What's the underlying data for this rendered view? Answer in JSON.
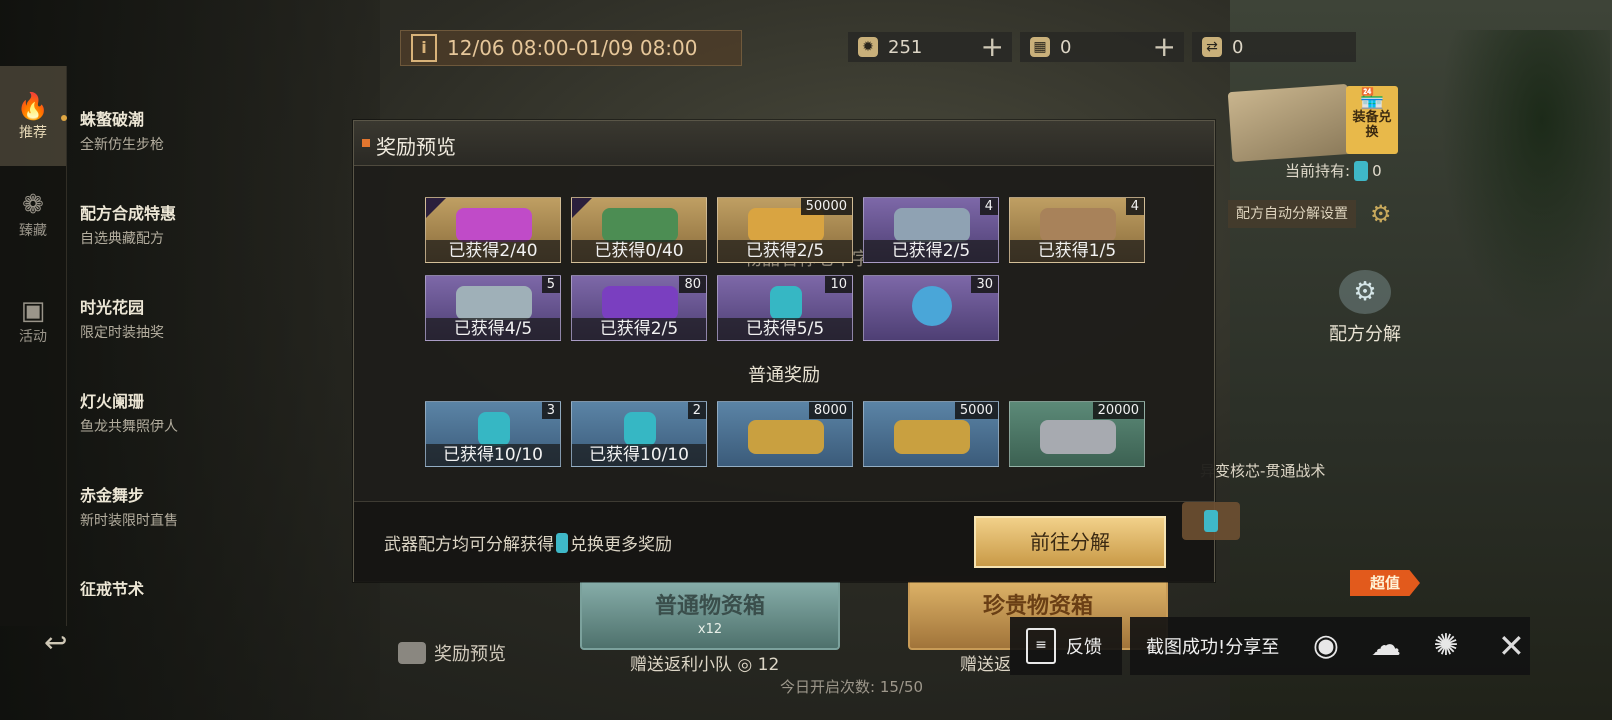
{
  "event": {
    "time_range": "12/06 08:00-01/09 08:00",
    "info_icon": "i"
  },
  "currencies": [
    {
      "icon": "sun-gear-icon",
      "value": "251",
      "plus": "+"
    },
    {
      "icon": "ticket-icon",
      "value": "0",
      "plus": "+"
    },
    {
      "icon": "token-icon",
      "value": "0"
    }
  ],
  "sidebar": {
    "tabs": [
      {
        "label": "推荐",
        "icon": "flame-icon"
      },
      {
        "label": "臻藏",
        "icon": "rose-icon"
      },
      {
        "label": "活动",
        "icon": "calendar-star-icon"
      }
    ],
    "menu": [
      {
        "title": "蛛螯破潮",
        "subtitle": "全新仿生步枪"
      },
      {
        "title": "配方合成特惠",
        "subtitle": "自选典藏配方"
      },
      {
        "title": "时光花园",
        "subtitle": "限定时装抽奖"
      },
      {
        "title": "灯火阑珊",
        "subtitle": "鱼龙共舞照伊人"
      },
      {
        "title": "赤金舞步",
        "subtitle": "新时装限时直售"
      },
      {
        "title": "征戒节术",
        "subtitle": ""
      }
    ]
  },
  "right_panel": {
    "shop_badge": "装备兑换",
    "holding_label": "当前持有:",
    "holding_value": "0",
    "auto_decompose": "配方自动分解设置",
    "decompose_label": "配方分解",
    "core_label": "异变核芯-贯通战术",
    "super_tag": "超值"
  },
  "modal": {
    "title": "奖励预览",
    "ghost_text": "物品名称七个字",
    "section_normal": "普通奖励",
    "row1": [
      {
        "color": "gold",
        "count": "",
        "obtained": "已获得2/40",
        "art": "#c04bc8"
      },
      {
        "color": "gold",
        "count": "",
        "obtained": "已获得0/40",
        "art": "#4c8d53"
      },
      {
        "color": "gold",
        "count": "50000",
        "obtained": "已获得2/5",
        "art": "#d9a441"
      },
      {
        "color": "purple",
        "count": "4",
        "obtained": "已获得2/5",
        "art": "#8fa2b3"
      },
      {
        "color": "gold",
        "count": "4",
        "obtained": "已获得1/5",
        "art": "#a8825a"
      }
    ],
    "row2": [
      {
        "color": "purple",
        "count": "5",
        "obtained": "已获得4/5",
        "art": "#9fb0b8"
      },
      {
        "color": "purple",
        "count": "80",
        "obtained": "已获得2/5",
        "art": "#7a3fc0"
      },
      {
        "color": "purple",
        "count": "10",
        "obtained": "已获得5/5",
        "art": "#36b7c4"
      },
      {
        "color": "purple",
        "count": "30",
        "obtained": "",
        "art": "#4aa6d8"
      }
    ],
    "row3": [
      {
        "color": "blue",
        "count": "3",
        "obtained": "已获得10/10",
        "art": "#36b7c4"
      },
      {
        "color": "blue",
        "count": "2",
        "obtained": "已获得10/10",
        "art": "#36b7c4"
      },
      {
        "color": "blue",
        "count": "8000",
        "obtained": "",
        "art": "#c9a040"
      },
      {
        "color": "blue",
        "count": "5000",
        "obtained": "",
        "art": "#c9a040"
      },
      {
        "color": "green",
        "count": "20000",
        "obtained": "",
        "art": "#a7aab0"
      }
    ],
    "footer_text_pre": "武器配方均可分解获得",
    "footer_text_post": "兑换更多奖励",
    "go_button": "前往分解"
  },
  "bottom": {
    "normal_box": "普通物资箱",
    "normal_qty": "x12",
    "rare_box": "珍贵物资箱",
    "gift_left": "赠送返利小队",
    "gift_left_value": "12",
    "gift_right": "赠送返",
    "daily_opens": "今日开启次数: 15/50",
    "preview_link": "奖励预览"
  },
  "overlay": {
    "feedback": "反馈",
    "share_text": "截图成功!分享至",
    "share_icons": [
      "weibo-icon",
      "wechat-icon",
      "camera-shutter-icon"
    ],
    "close": "✕"
  }
}
